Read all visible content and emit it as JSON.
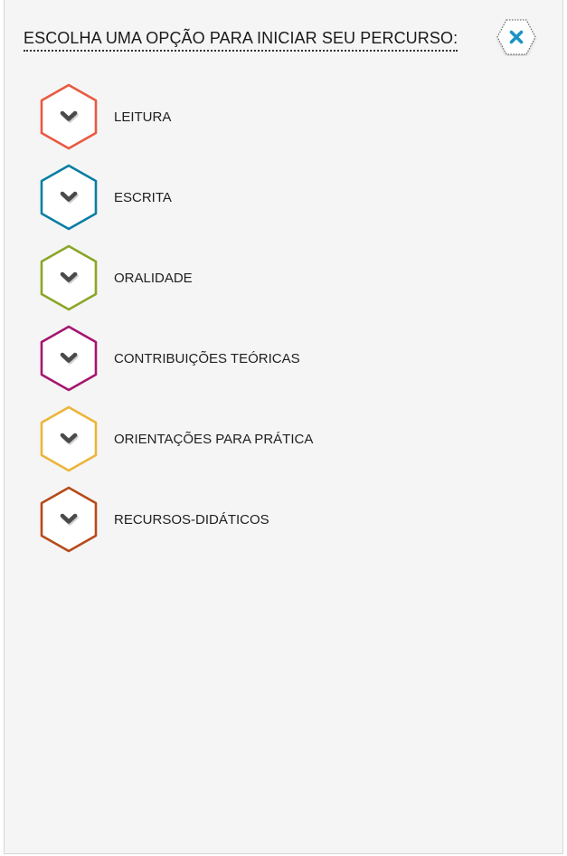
{
  "header": {
    "title": "ESCOLHA UMA OPÇÃO PARA INICIAR SEU PERCURSO:",
    "close_icon": "close-icon",
    "close_color": "#1a94c4"
  },
  "options": [
    {
      "label": "LEITURA",
      "color": "#e85a40",
      "icon": "chevron-down-icon"
    },
    {
      "label": "ESCRITA",
      "color": "#0a7ea4",
      "icon": "chevron-down-icon"
    },
    {
      "label": "ORALIDADE",
      "color": "#8aa629",
      "icon": "chevron-down-icon"
    },
    {
      "label": "CONTRIBUIÇÕES TEÓRICAS",
      "color": "#a5166f",
      "icon": "chevron-down-icon"
    },
    {
      "label": "ORIENTAÇÕES PARA PRÁTICA",
      "color": "#ecb53a",
      "icon": "chevron-down-icon"
    },
    {
      "label": "RECURSOS-DIDÁTICOS",
      "color": "#b54b1a",
      "icon": "chevron-down-icon"
    }
  ]
}
